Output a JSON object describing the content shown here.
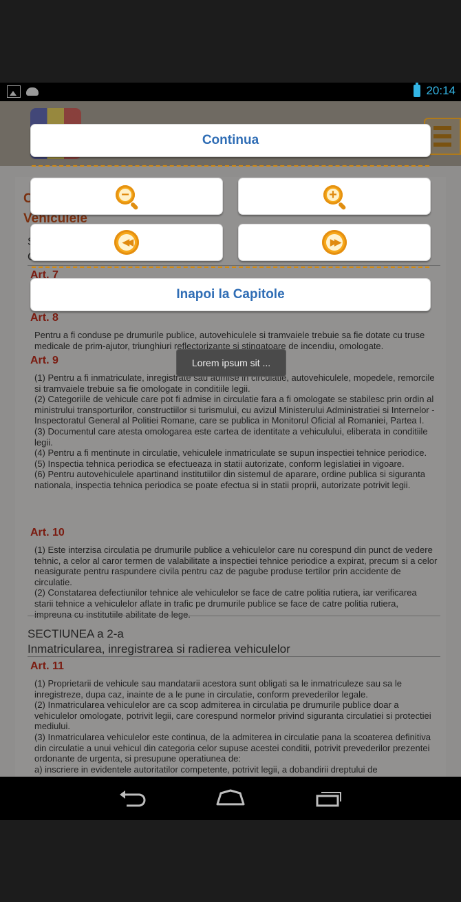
{
  "status_bar": {
    "time": "20:14",
    "left_icons": [
      "image-icon",
      "android-bot-icon"
    ],
    "battery_icon": "battery-charging-icon"
  },
  "background_page": {
    "chapter_title_fragment": "C",
    "chapter_subtitle": "Vehiculele",
    "section1_fragment_a": "S",
    "section1_fragment_b": "C",
    "section1_visible_tail": "...",
    "art7": "Art. 7",
    "art8": "Art. 8",
    "art8_text": "Pentru a fi conduse pe drumurile publice, autovehiculele si tramvaiele trebuie sa fie dotate cu truse medicale de prim-ajutor, triunghiuri reflectorizante si stingatoare de incendiu, omologate.",
    "art9": "Art. 9",
    "art9_text": "(1) Pentru a fi inmatriculate, inregistrate sau admise in circulatie, autovehiculele, mopedele, remorcile si tramvaiele trebuie sa fie omologate in conditiile legii.\n(2) Categoriile de vehicule care pot fi admise in circulatie fara a fi omologate se stabilesc prin ordin al ministrului transporturilor, constructiilor si turismului, cu avizul Ministerului Administratiei si Internelor - Inspectoratul General al Politiei Romane, care se publica in Monitorul Oficial al Romaniei, Partea I.\n(3) Documentul care atesta omologarea este cartea de identitate a vehiculului, eliberata in conditiile legii.\n(4) Pentru a fi mentinute in circulatie, vehiculele inmatriculate se supun inspectiei tehnice periodice.\n(5) Inspectia tehnica periodica se efectueaza in statii autorizate, conform legislatiei in vigoare.\n(6) Pentru autovehiculele apartinand institutiilor din sistemul de aparare, ordine publica si siguranta nationala, inspectia tehnica periodica se poate efectua si in statii proprii, autorizate potrivit legii.",
    "art10": "Art. 10",
    "art10_text": "(1) Este interzisa circulatia pe drumurile publice a vehiculelor care nu corespund din punct de vedere tehnic, a celor al caror termen de valabilitate a inspectiei tehnice periodice a expirat, precum si a celor neasigurate pentru raspundere civila pentru caz de pagube produse tertilor prin accidente de circulatie.\n(2) Constatarea defectiunilor tehnice ale vehiculelor se face de catre politia rutiera, iar verificarea starii tehnice a vehiculelor aflate in trafic pe drumurile publice se face de catre politia rutiera, impreuna cu institutiile abilitate de lege.",
    "section2_label": "SECTIUNEA a 2-a",
    "section2_title": "Inmatricularea, inregistrarea si radierea vehiculelor",
    "art11": "Art. 11",
    "art11_text": "(1) Proprietarii de vehicule sau mandatarii acestora sunt obligati sa le inmatriculeze sau sa le inregistreze, dupa caz, inainte de a le pune in circulatie, conform prevederilor legale.\n(2) Inmatricularea vehiculelor are ca scop admiterea in circulatia pe drumurile publice doar a vehiculelor omologate, potrivit legii, care corespund normelor privind siguranta circulatiei si protectiei mediului.\n(3) Inmatricularea vehiculelor este continua, de la admiterea in circulatie pana la scoaterea definitiva din circulatie a unui vehicul din categoria celor supuse acestei conditii, potrivit prevederilor prezentei ordonante de urgenta, si presupune operatiunea de:\na) inscriere in evidentele autoritatilor competente, potrivit legii, a dobandirii dreptului de"
  },
  "dialog": {
    "continue_label": "Continua",
    "back_to_chapters_label": "Inapoi la Capitole",
    "zoom_out_icon": "zoom-out-icon",
    "zoom_in_icon": "zoom-in-icon",
    "previous_icon": "rewind-icon",
    "next_icon": "fast-forward-icon"
  },
  "toast": {
    "text": "Lorem ipsum sit ..."
  },
  "nav_bar": {
    "icons": [
      "back-icon",
      "home-icon",
      "recent-apps-icon"
    ]
  },
  "colors": {
    "link_blue": "#2f6db5",
    "accent_orange": "#f6a91a",
    "status_blue": "#33b5e5"
  }
}
